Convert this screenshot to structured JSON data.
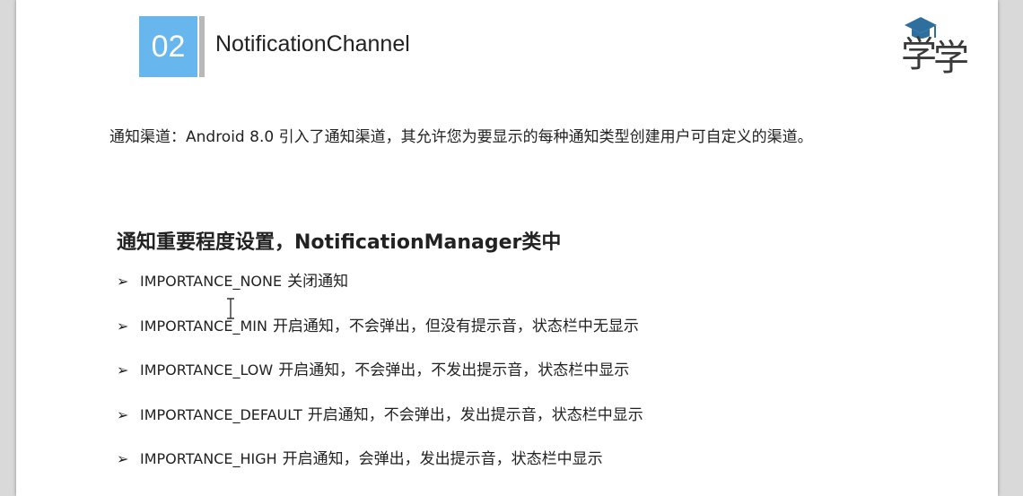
{
  "slide": {
    "number": "02",
    "title": "NotificationChannel",
    "logo_text": "学",
    "intro": "通知渠道：Android 8.0 引入了通知渠道，其允许您为要显示的每种通知类型创建用户可自定义的渠道。",
    "section_title": "通知重要程度设置，NotificationManager类中",
    "items": [
      {
        "bullet": "➢",
        "code": "IMPORTANCE_NONE",
        "desc": "关闭通知"
      },
      {
        "bullet": "➢",
        "code": "IMPORTANCE_MIN",
        "desc": "开启通知，不会弹出，但没有提示音，状态栏中无显示"
      },
      {
        "bullet": "➢",
        "code": "IMPORTANCE_LOW",
        "desc": "开启通知，不会弹出，不发出提示音，状态栏中显示"
      },
      {
        "bullet": "➢",
        "code": "IMPORTANCE_DEFAULT",
        "desc": "开启通知，不会弹出，发出提示音，状态栏中显示"
      },
      {
        "bullet": "➢",
        "code": "IMPORTANCE_HIGH",
        "desc": "开启通知，会弹出，发出提示音，状态栏中显示"
      }
    ]
  },
  "colors": {
    "number_box": "#68b6ee",
    "number_bar": "#b8b8b8",
    "logo": "#2f6f9e"
  }
}
